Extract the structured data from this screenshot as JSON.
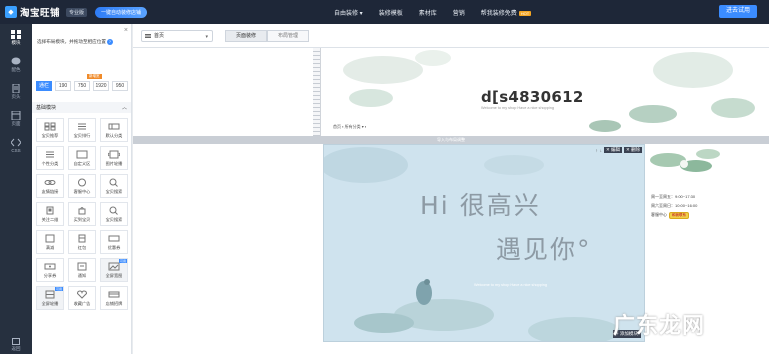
{
  "app": {
    "logo_text": "淘宝旺铺",
    "edition": "专业版",
    "promo": "一键自动装修店铺"
  },
  "topnav": [
    {
      "label": "自由装修 ▾"
    },
    {
      "label": "装修模板"
    },
    {
      "label": "素材库"
    },
    {
      "label": "营销"
    },
    {
      "label": "帮我装修免费"
    }
  ],
  "topnav_hot": "HOT",
  "trial_button": "进去试用",
  "rail": [
    {
      "label": "模块",
      "icon": "grid-icon"
    },
    {
      "label": "配色",
      "icon": "chat-icon"
    },
    {
      "label": "页头",
      "icon": "doc-icon"
    },
    {
      "label": "页面",
      "icon": "page-icon"
    },
    {
      "label": "CSS",
      "icon": "code-icon"
    }
  ],
  "rail_bottom": "返回",
  "panel": {
    "tip": "选择布局模块，并拖动至相应位置",
    "width_badge": "新增宽",
    "widths": [
      "通栏",
      "190",
      "750",
      "1920",
      "950"
    ],
    "section": "基础模块",
    "modules": [
      {
        "label": "宝贝推荐"
      },
      {
        "label": "宝贝排行"
      },
      {
        "label": "默认分类"
      },
      {
        "label": "个性分类"
      },
      {
        "label": "自定义区"
      },
      {
        "label": "图片轮播"
      },
      {
        "label": "友情链接"
      },
      {
        "label": "客服中心"
      },
      {
        "label": "宝贝搜索"
      },
      {
        "label": "关注二维"
      },
      {
        "label": "买到宝贝"
      },
      {
        "label": "宝贝搜索"
      },
      {
        "label": "满减"
      },
      {
        "label": "红包"
      },
      {
        "label": "优惠券"
      },
      {
        "label": "分享券"
      },
      {
        "label": "通知"
      },
      {
        "label": "全屏宽图"
      },
      {
        "label": "全屏轮播"
      },
      {
        "label": "收藏广告"
      },
      {
        "label": "店铺招牌"
      }
    ],
    "module_flag": "可用"
  },
  "editor": {
    "page_select": "首页",
    "tabs": [
      "页面装修",
      "布局管理"
    ],
    "shop_name": "d[s4830612",
    "shop_sub": "Welcome to my shop  Have a nice shopping",
    "mini_nav": "首页 ▪ 所有分类 ▾        ▪",
    "separator": "导入与布局调整",
    "hero_tools": [
      "↑",
      "↓",
      "✕ 编辑",
      "✕ 删除"
    ],
    "hero_line1": "Hi  很高兴",
    "hero_line2": "遇见你°",
    "hero_sub": "Welcome to my shop  Have a nice shopping",
    "add_module": "+ 添加模块",
    "side_rows": [
      "周一至周五：9:00~17:30",
      "周六至周日：10:00~16:00"
    ],
    "side_service": "客服中心",
    "side_badge": "和我联系"
  },
  "watermark": "广东龙网",
  "colors": {
    "topbar": "#1e2738",
    "rail": "#26303f",
    "accent": "#3b8cff",
    "hero_bg": "#cfe3ee"
  }
}
